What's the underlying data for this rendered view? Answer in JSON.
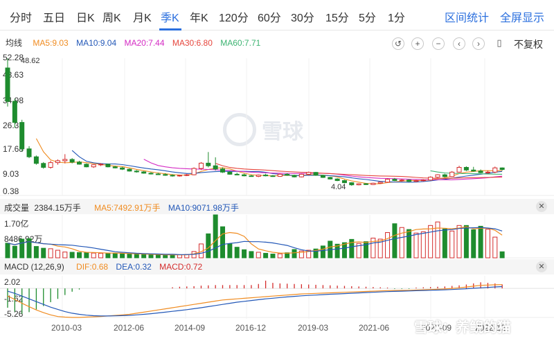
{
  "tabs": {
    "items": [
      "分时",
      "五日",
      "日K",
      "周K",
      "月K",
      "季K",
      "年K",
      "120分",
      "60分",
      "30分",
      "15分",
      "5分",
      "1分"
    ],
    "active": "季K",
    "right": [
      "区间统计",
      "全屏显示"
    ]
  },
  "toolbar": {
    "icons": [
      "undo-icon",
      "zoom-in-icon",
      "zoom-out-icon",
      "pan-left-icon",
      "pan-right-icon",
      "candle-type-icon"
    ],
    "adjust_label": "不复权"
  },
  "main_legend": {
    "title": "均线",
    "items": [
      "MA5:9.03",
      "MA10:9.04",
      "MA20:7.44",
      "MA30:6.80",
      "MA60:7.71"
    ],
    "colors": [
      "#f08c21",
      "#2257b7",
      "#d42bc4",
      "#e6453c",
      "#3cb371"
    ]
  },
  "price_axis": {
    "labels": [
      "52.28",
      "43.63",
      "34.98",
      "26.33",
      "17.68",
      "9.03",
      "0.38"
    ],
    "max_label": "48.62",
    "min_label": "4.04"
  },
  "volume_legend": {
    "title": "成交量",
    "value": "2384.15万手",
    "items": [
      "MA5:7492.91万手",
      "MA10:9071.98万手"
    ],
    "colors": [
      "#f08c21",
      "#2257b7"
    ]
  },
  "volume_axis": {
    "labels": [
      "1.70亿",
      "8486.92万"
    ]
  },
  "macd_legend": {
    "title": "MACD (12,26,9)",
    "items": [
      "DIF:0.68",
      "DEA:0.32",
      "MACD:0.72"
    ],
    "colors": [
      "#f08c21",
      "#2257b7",
      "#d42b2b"
    ]
  },
  "macd_axis": {
    "labels": [
      "2.02",
      "-1.62",
      "-5.26"
    ]
  },
  "x_axis": {
    "ticks": [
      "2010-03",
      "2012-06",
      "2014-09",
      "2016-12",
      "2019-03",
      "2021-06",
      "2022-09",
      "2022-12"
    ]
  },
  "watermark": {
    "text": "雪球",
    "corner": "雪球：养鲵的猫"
  },
  "colors": {
    "up": "#d42b2b",
    "down": "#1e8c2e",
    "accent": "#2b6fde"
  },
  "chart_data": {
    "type": "candlestick",
    "frequency": "quarterly",
    "price_range": [
      0.38,
      52.28
    ],
    "candles": [
      {
        "o": 48.6,
        "h": 52.3,
        "l": 34.0,
        "c": 36.0
      },
      {
        "o": 36.0,
        "h": 37.0,
        "l": 26.0,
        "c": 28.0
      },
      {
        "o": 28.0,
        "h": 29.0,
        "l": 17.0,
        "c": 18.0
      },
      {
        "o": 18.0,
        "h": 19.0,
        "l": 14.5,
        "c": 15.0
      },
      {
        "o": 15.0,
        "h": 15.5,
        "l": 12.0,
        "c": 12.5
      },
      {
        "o": 12.5,
        "h": 13.0,
        "l": 10.5,
        "c": 11.0
      },
      {
        "o": 11.0,
        "h": 13.5,
        "l": 10.5,
        "c": 12.8
      },
      {
        "o": 12.8,
        "h": 14.0,
        "l": 12.0,
        "c": 13.5
      },
      {
        "o": 13.5,
        "h": 16.0,
        "l": 12.5,
        "c": 14.0
      },
      {
        "o": 14.0,
        "h": 14.5,
        "l": 12.5,
        "c": 13.0
      },
      {
        "o": 13.0,
        "h": 13.5,
        "l": 12.0,
        "c": 12.2
      },
      {
        "o": 12.2,
        "h": 12.5,
        "l": 11.0,
        "c": 11.2
      },
      {
        "o": 11.2,
        "h": 12.2,
        "l": 10.8,
        "c": 12.0
      },
      {
        "o": 12.0,
        "h": 12.6,
        "l": 11.5,
        "c": 12.2
      },
      {
        "o": 12.2,
        "h": 12.4,
        "l": 11.0,
        "c": 11.2
      },
      {
        "o": 11.2,
        "h": 11.6,
        "l": 10.6,
        "c": 10.8
      },
      {
        "o": 10.8,
        "h": 11.2,
        "l": 10.0,
        "c": 10.3
      },
      {
        "o": 10.3,
        "h": 10.6,
        "l": 9.4,
        "c": 9.6
      },
      {
        "o": 9.6,
        "h": 10.0,
        "l": 9.0,
        "c": 9.3
      },
      {
        "o": 9.3,
        "h": 9.6,
        "l": 8.6,
        "c": 8.8
      },
      {
        "o": 8.8,
        "h": 9.2,
        "l": 8.3,
        "c": 8.5
      },
      {
        "o": 8.5,
        "h": 9.0,
        "l": 8.1,
        "c": 8.3
      },
      {
        "o": 8.3,
        "h": 8.8,
        "l": 7.8,
        "c": 8.0
      },
      {
        "o": 8.0,
        "h": 8.4,
        "l": 7.5,
        "c": 7.8
      },
      {
        "o": 7.8,
        "h": 8.2,
        "l": 7.5,
        "c": 8.0
      },
      {
        "o": 8.0,
        "h": 8.5,
        "l": 7.7,
        "c": 8.2
      },
      {
        "o": 8.2,
        "h": 11.0,
        "l": 8.0,
        "c": 10.6
      },
      {
        "o": 10.6,
        "h": 13.0,
        "l": 10.0,
        "c": 12.6
      },
      {
        "o": 12.6,
        "h": 16.8,
        "l": 11.0,
        "c": 11.6
      },
      {
        "o": 11.6,
        "h": 14.8,
        "l": 9.8,
        "c": 10.4
      },
      {
        "o": 10.4,
        "h": 11.0,
        "l": 8.9,
        "c": 9.2
      },
      {
        "o": 9.2,
        "h": 9.6,
        "l": 8.2,
        "c": 8.4
      },
      {
        "o": 8.4,
        "h": 9.0,
        "l": 8.0,
        "c": 8.2
      },
      {
        "o": 8.2,
        "h": 8.6,
        "l": 7.6,
        "c": 7.8
      },
      {
        "o": 7.8,
        "h": 8.2,
        "l": 7.5,
        "c": 7.6
      },
      {
        "o": 7.6,
        "h": 8.3,
        "l": 7.3,
        "c": 8.1
      },
      {
        "o": 8.1,
        "h": 8.6,
        "l": 7.6,
        "c": 7.8
      },
      {
        "o": 7.8,
        "h": 8.1,
        "l": 7.4,
        "c": 7.6
      },
      {
        "o": 7.6,
        "h": 8.6,
        "l": 7.4,
        "c": 8.4
      },
      {
        "o": 8.4,
        "h": 8.8,
        "l": 7.8,
        "c": 8.0
      },
      {
        "o": 8.0,
        "h": 8.2,
        "l": 7.2,
        "c": 7.4
      },
      {
        "o": 7.4,
        "h": 8.6,
        "l": 7.2,
        "c": 8.4
      },
      {
        "o": 8.4,
        "h": 9.4,
        "l": 8.0,
        "c": 9.1
      },
      {
        "o": 9.1,
        "h": 9.3,
        "l": 7.8,
        "c": 8.0
      },
      {
        "o": 8.0,
        "h": 8.2,
        "l": 7.0,
        "c": 7.2
      },
      {
        "o": 7.2,
        "h": 7.5,
        "l": 6.4,
        "c": 6.6
      },
      {
        "o": 6.6,
        "h": 6.9,
        "l": 5.8,
        "c": 6.0
      },
      {
        "o": 6.0,
        "h": 6.3,
        "l": 5.0,
        "c": 5.2
      },
      {
        "o": 5.2,
        "h": 5.4,
        "l": 4.04,
        "c": 4.4
      },
      {
        "o": 4.4,
        "h": 5.0,
        "l": 4.2,
        "c": 4.8
      },
      {
        "o": 4.8,
        "h": 5.1,
        "l": 4.3,
        "c": 4.5
      },
      {
        "o": 4.5,
        "h": 5.2,
        "l": 4.3,
        "c": 5.0
      },
      {
        "o": 5.0,
        "h": 5.6,
        "l": 4.8,
        "c": 5.4
      },
      {
        "o": 5.4,
        "h": 6.8,
        "l": 5.2,
        "c": 6.5
      },
      {
        "o": 6.5,
        "h": 7.0,
        "l": 5.8,
        "c": 6.0
      },
      {
        "o": 6.0,
        "h": 6.6,
        "l": 5.6,
        "c": 6.2
      },
      {
        "o": 6.2,
        "h": 6.5,
        "l": 5.5,
        "c": 5.7
      },
      {
        "o": 5.7,
        "h": 6.2,
        "l": 5.4,
        "c": 6.0
      },
      {
        "o": 6.0,
        "h": 6.5,
        "l": 5.7,
        "c": 6.2
      },
      {
        "o": 6.2,
        "h": 7.6,
        "l": 6.0,
        "c": 7.3
      },
      {
        "o": 7.3,
        "h": 8.4,
        "l": 7.0,
        "c": 8.2
      },
      {
        "o": 8.2,
        "h": 8.6,
        "l": 7.2,
        "c": 7.5
      },
      {
        "o": 7.5,
        "h": 9.6,
        "l": 7.3,
        "c": 9.2
      },
      {
        "o": 9.2,
        "h": 11.6,
        "l": 9.0,
        "c": 11.0
      },
      {
        "o": 11.0,
        "h": 11.4,
        "l": 9.6,
        "c": 10.0
      },
      {
        "o": 10.0,
        "h": 11.2,
        "l": 9.4,
        "c": 9.6
      },
      {
        "o": 9.6,
        "h": 10.2,
        "l": 8.8,
        "c": 9.0
      },
      {
        "o": 9.0,
        "h": 9.8,
        "l": 8.6,
        "c": 9.2
      },
      {
        "o": 9.2,
        "h": 11.3,
        "l": 8.8,
        "c": 10.8
      },
      {
        "o": 10.8,
        "h": 11.0,
        "l": 9.8,
        "c": 10.2
      }
    ],
    "volume": [
      5.8,
      4.6,
      7.4,
      7.6,
      4.5,
      3.8,
      3.6,
      3.0,
      2.3,
      2.2,
      2.1,
      2.0,
      1.9,
      1.8,
      1.8,
      1.8,
      1.6,
      1.5,
      1.4,
      1.3,
      1.2,
      1.2,
      1.1,
      1.1,
      1.2,
      1.3,
      2.5,
      5.5,
      9.5,
      17.0,
      12.3,
      5.5,
      4.2,
      3.2,
      2.5,
      2.2,
      1.8,
      1.5,
      1.6,
      2.0,
      3.3,
      2.7,
      3.0,
      3.5,
      4.7,
      6.6,
      5.4,
      6.0,
      7.3,
      5.7,
      6.4,
      7.8,
      7.4,
      10.0,
      13.5,
      12.0,
      11.2,
      9.8,
      10.3,
      12.8,
      14.2,
      11.4,
      10.6,
      12.8,
      12.8,
      11.1,
      12.5,
      11.3,
      8.2,
      2.4
    ],
    "volume_unit": "千万手",
    "volume_range": [
      0,
      17.0
    ],
    "volume_ma5": [
      5.8,
      5.2,
      5.9,
      6.4,
      6.0,
      5.6,
      5.4,
      4.6,
      4.3,
      3.6,
      2.6,
      2.2,
      2.1,
      2.0,
      1.9,
      1.9,
      1.8,
      1.7,
      1.6,
      1.5,
      1.4,
      1.3,
      1.2,
      1.2,
      1.2,
      1.2,
      1.6,
      2.4,
      3.9,
      6.8,
      9.5,
      10.0,
      9.7,
      8.5,
      5.5,
      3.5,
      2.8,
      2.2,
      1.9,
      1.8,
      2.0,
      2.2,
      2.5,
      2.9,
      3.4,
      4.3,
      4.7,
      5.4,
      6.1,
      6.3,
      6.1,
      6.5,
      6.7,
      7.6,
      8.9,
      9.8,
      10.4,
      11.2,
      11.4,
      11.5,
      11.8,
      11.7,
      11.5,
      11.8,
      12.3,
      11.5,
      11.7,
      11.7,
      10.9,
      9.0
    ],
    "volume_ma10": [
      5.8,
      5.2,
      5.9,
      6.4,
      6.0,
      5.6,
      5.4,
      5.2,
      5.1,
      5.0,
      4.6,
      4.3,
      3.9,
      3.4,
      2.9,
      2.4,
      2.2,
      2.0,
      1.8,
      1.7,
      1.6,
      1.5,
      1.4,
      1.4,
      1.3,
      1.3,
      1.4,
      1.8,
      2.6,
      3.9,
      5.3,
      5.7,
      6.0,
      6.5,
      6.4,
      6.4,
      6.2,
      5.9,
      5.4,
      4.9,
      4.0,
      3.2,
      2.7,
      2.6,
      2.9,
      3.2,
      3.5,
      3.8,
      4.4,
      4.8,
      5.2,
      5.9,
      6.2,
      6.9,
      7.6,
      8.1,
      8.6,
      9.2,
      9.7,
      10.2,
      10.7,
      11.0,
      11.2,
      11.6,
      11.8,
      11.9,
      12.0,
      11.8,
      11.5,
      10.6
    ],
    "macd_range": [
      -5.26,
      2.02
    ],
    "macd_hist": [
      -3.5,
      -4.2,
      -4.6,
      -4.3,
      -3.8,
      -3.2,
      -2.5,
      -1.9,
      -1.2,
      -0.6,
      -0.2,
      0.0,
      0.0,
      0.0,
      0.0,
      0.0,
      0.0,
      0.0,
      0.0,
      0.0,
      0.0,
      0.0,
      0.0,
      0.2,
      0.3,
      0.35,
      0.4,
      0.5,
      0.55,
      0.6,
      0.6,
      0.6,
      0.6,
      0.6,
      0.6,
      0.8,
      1.4,
      1.0,
      0.9,
      0.85,
      0.8,
      0.75,
      0.7,
      0.65,
      0.6,
      0.55,
      0.5,
      0.45,
      0.4,
      0.35,
      0.3,
      0.25,
      0.2,
      0.15,
      -0.1,
      -0.1,
      -0.1,
      0.15,
      0.2,
      0.25,
      0.3,
      0.35,
      0.45,
      0.55,
      0.7,
      0.9,
      1.1,
      1.0,
      0.9,
      0.72
    ],
    "macd_dif": [
      -1.4,
      -2.0,
      -2.7,
      -3.3,
      -3.9,
      -4.4,
      -4.8,
      -5.1,
      -5.2,
      -5.26,
      -5.26,
      -5.2,
      -5.15,
      -5.1,
      -5.0,
      -4.9,
      -4.8,
      -4.7,
      -4.5,
      -4.3,
      -4.1,
      -3.9,
      -3.7,
      -3.5,
      -3.3,
      -3.1,
      -2.9,
      -2.7,
      -2.5,
      -2.3,
      -2.1,
      -2.0,
      -1.9,
      -1.8,
      -1.7,
      -1.6,
      -1.5,
      -1.4,
      -1.3,
      -1.2,
      -1.1,
      -1.0,
      -0.95,
      -0.9,
      -0.85,
      -0.8,
      -0.75,
      -0.7,
      -0.65,
      -0.6,
      -0.55,
      -0.5,
      -0.45,
      -0.4,
      -0.38,
      -0.36,
      -0.34,
      -0.3,
      -0.25,
      -0.2,
      -0.15,
      -0.1,
      0.0,
      0.1,
      0.25,
      0.4,
      0.55,
      0.6,
      0.65,
      0.68
    ],
    "macd_dea": [
      -0.5,
      -0.9,
      -1.4,
      -1.9,
      -2.4,
      -2.9,
      -3.4,
      -3.8,
      -4.2,
      -4.5,
      -4.7,
      -4.85,
      -4.95,
      -5.0,
      -5.0,
      -4.97,
      -4.93,
      -4.88,
      -4.8,
      -4.7,
      -4.58,
      -4.45,
      -4.3,
      -4.15,
      -4.0,
      -3.85,
      -3.68,
      -3.5,
      -3.3,
      -3.1,
      -2.9,
      -2.7,
      -2.5,
      -2.35,
      -2.2,
      -2.05,
      -1.9,
      -1.78,
      -1.66,
      -1.55,
      -1.45,
      -1.35,
      -1.27,
      -1.2,
      -1.13,
      -1.06,
      -1.0,
      -0.94,
      -0.88,
      -0.82,
      -0.76,
      -0.7,
      -0.64,
      -0.58,
      -0.54,
      -0.5,
      -0.46,
      -0.42,
      -0.38,
      -0.34,
      -0.3,
      -0.26,
      -0.2,
      -0.14,
      -0.06,
      0.02,
      0.1,
      0.18,
      0.26,
      0.32
    ]
  }
}
